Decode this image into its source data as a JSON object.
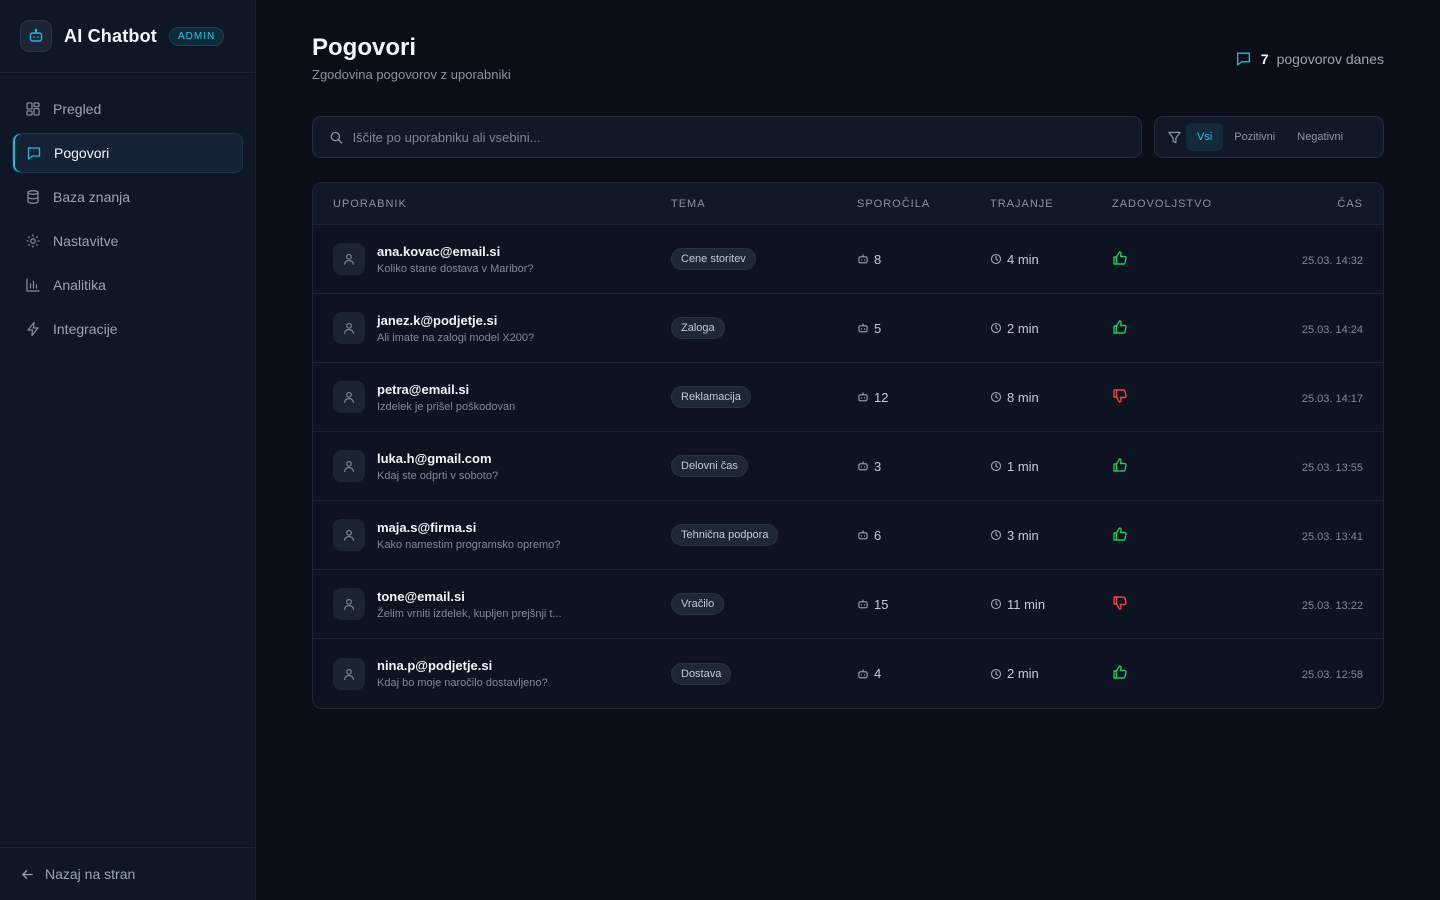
{
  "app": {
    "title": "AI Chatbot",
    "badge": "ADMIN"
  },
  "sidebar": {
    "items": [
      {
        "label": "Pregled",
        "icon": "dashboard-icon",
        "active": false
      },
      {
        "label": "Pogovori",
        "icon": "chat-icon",
        "active": true
      },
      {
        "label": "Baza znanja",
        "icon": "database-icon",
        "active": false
      },
      {
        "label": "Nastavitve",
        "icon": "gear-icon",
        "active": false
      },
      {
        "label": "Analitika",
        "icon": "bar-chart-icon",
        "active": false
      },
      {
        "label": "Integracije",
        "icon": "lightning-icon",
        "active": false
      }
    ],
    "back_label": "Nazaj na stran"
  },
  "header": {
    "title": "Pogovori",
    "subtitle": "Zgodovina pogovorov z uporabniki",
    "today_count": "7",
    "today_label": "pogovorov danes"
  },
  "search": {
    "placeholder": "Iščite po uporabniku ali vsebini...",
    "value": ""
  },
  "filter": {
    "options": [
      "Vsi",
      "Pozitivni",
      "Negativni"
    ],
    "active": "Vsi"
  },
  "table": {
    "columns": [
      "UPORABNIK",
      "TEMA",
      "SPOROČILA",
      "TRAJANJE",
      "ZADOVOLJSTVO",
      "ČAS"
    ],
    "rows": [
      {
        "email": "ana.kovac@email.si",
        "message": "Koliko stane dostava v Maribor?",
        "topic": "Cene storitev",
        "messages": "8",
        "duration": "4 min",
        "satisfaction": "positive",
        "time": "25.03. 14:32"
      },
      {
        "email": "janez.k@podjetje.si",
        "message": "Ali imate na zalogi model X200?",
        "topic": "Zaloga",
        "messages": "5",
        "duration": "2 min",
        "satisfaction": "positive",
        "time": "25.03. 14:24"
      },
      {
        "email": "petra@email.si",
        "message": "Izdelek je prišel poškodovan",
        "topic": "Reklamacija",
        "messages": "12",
        "duration": "8 min",
        "satisfaction": "negative",
        "time": "25.03. 14:17"
      },
      {
        "email": "luka.h@gmail.com",
        "message": "Kdaj ste odprti v soboto?",
        "topic": "Delovni čas",
        "messages": "3",
        "duration": "1 min",
        "satisfaction": "positive",
        "time": "25.03. 13:55"
      },
      {
        "email": "maja.s@firma.si",
        "message": "Kako namestim programsko opremo?",
        "topic": "Tehnična podpora",
        "messages": "6",
        "duration": "3 min",
        "satisfaction": "positive",
        "time": "25.03. 13:41"
      },
      {
        "email": "tone@email.si",
        "message": "Želim vrniti izdelek, kupljen prejšnji t...",
        "topic": "Vračilo",
        "messages": "15",
        "duration": "11 min",
        "satisfaction": "negative",
        "time": "25.03. 13:22"
      },
      {
        "email": "nina.p@podjetje.si",
        "message": "Kdaj bo moje naročilo dostavljeno?",
        "topic": "Dostava",
        "messages": "4",
        "duration": "2 min",
        "satisfaction": "positive",
        "time": "25.03. 12:58"
      }
    ]
  },
  "colors": {
    "accent": "#22b8d6",
    "positive": "#22c55e",
    "negative": "#ef4444",
    "background": "#0a0e17",
    "sidebar": "#0f1625"
  }
}
